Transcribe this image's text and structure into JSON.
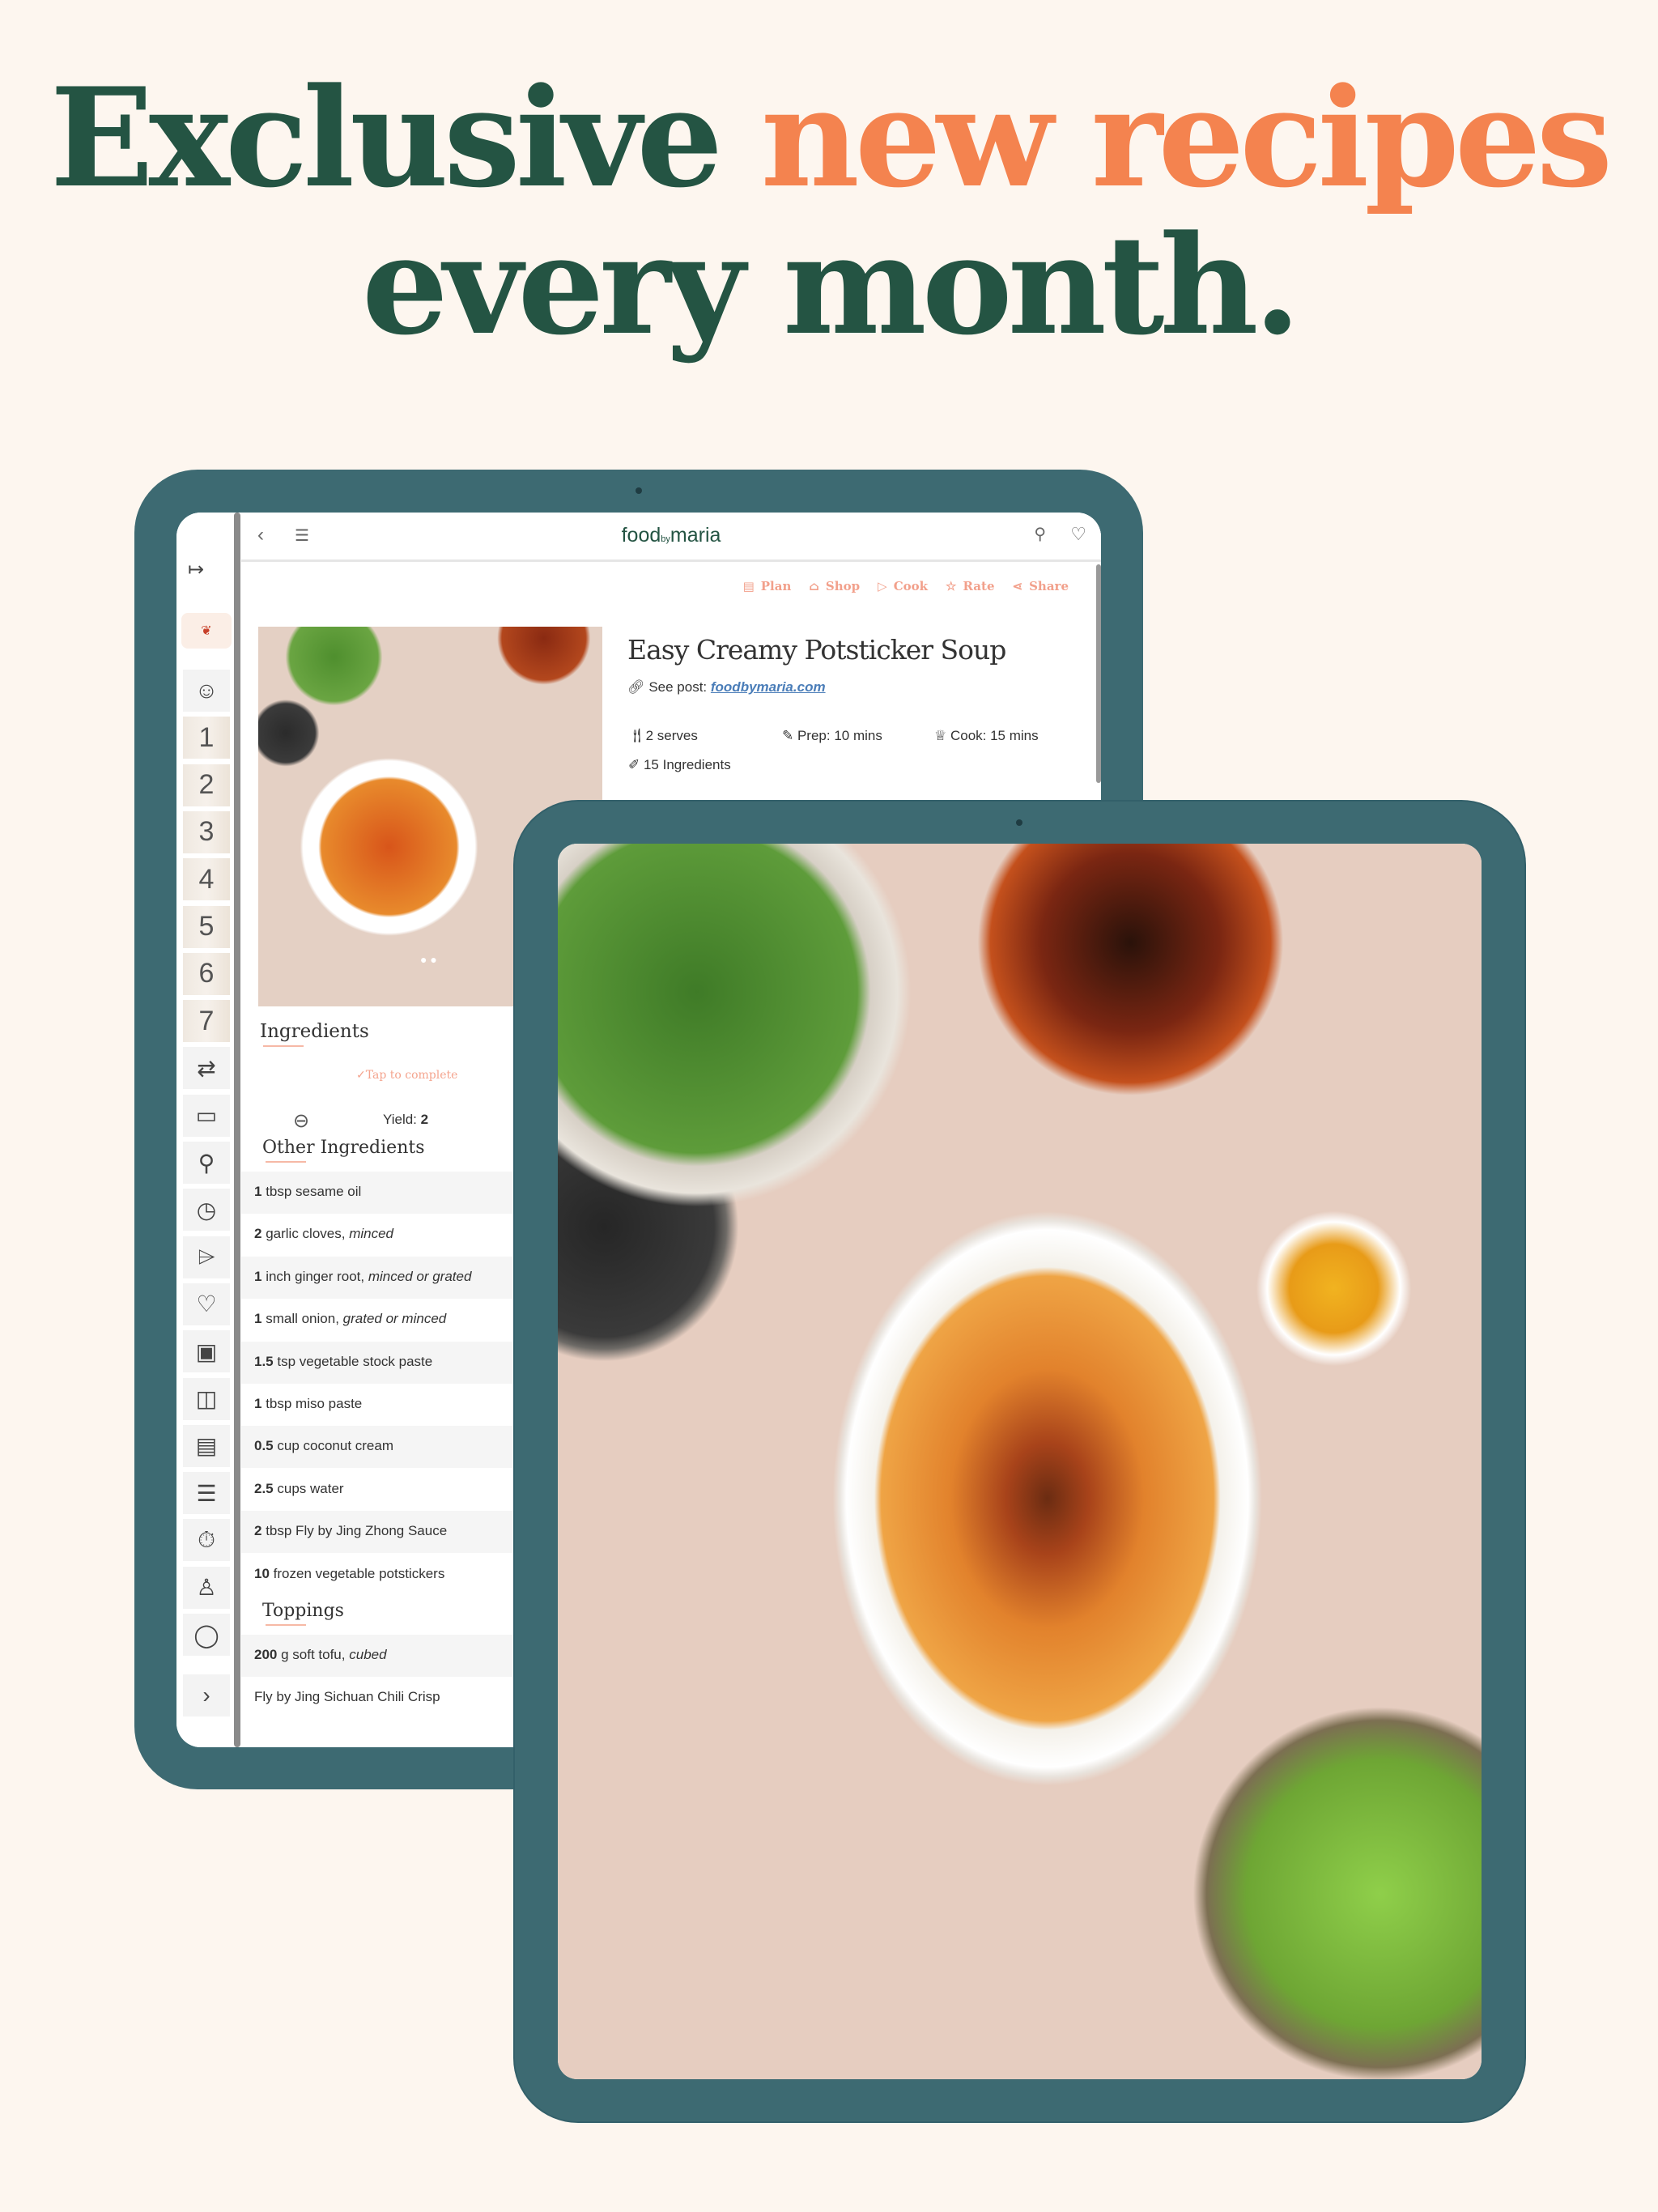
{
  "headline": {
    "line1_a": "Exclusive ",
    "line1_b": "new recipes",
    "line2": "every month."
  },
  "colors": {
    "background": "#fdf6ef",
    "brand_green": "#245443",
    "accent_orange": "#f4834f",
    "bezel": "#3d6a72",
    "action_pink": "#f2a08b",
    "link_blue": "#4a7db8"
  },
  "app": {
    "logo": {
      "food": "food",
      "by": "by",
      "maria": "maria"
    },
    "topbar": {
      "back_icon": "chevron-left-icon",
      "menu_icon": "hamburger-icon",
      "pin_icon": "pin-icon",
      "favorite_icon": "heart-icon"
    },
    "sidebar": {
      "expand_icon": "arrow-right-bar-icon",
      "logo_alt": "foodbymaria",
      "items": [
        {
          "icon": "user-icon"
        },
        {
          "label": "1"
        },
        {
          "label": "2"
        },
        {
          "label": "3"
        },
        {
          "label": "4"
        },
        {
          "label": "5"
        },
        {
          "label": "6"
        },
        {
          "label": "7"
        },
        {
          "icon": "swap-icon"
        },
        {
          "icon": "book-icon"
        },
        {
          "icon": "search-icon"
        },
        {
          "icon": "clock-icon"
        },
        {
          "icon": "tags-icon"
        },
        {
          "icon": "heart-icon"
        },
        {
          "icon": "pantry-icon"
        },
        {
          "icon": "saved-icon"
        },
        {
          "icon": "calendar-icon"
        },
        {
          "icon": "checklist-icon"
        },
        {
          "icon": "timer-icon"
        },
        {
          "icon": "chef-icon"
        },
        {
          "icon": "chat-icon"
        }
      ],
      "next_icon": "chevron-right-icon"
    },
    "actions": [
      {
        "label": "Plan",
        "icon": "calendar-icon"
      },
      {
        "label": "Shop",
        "icon": "basket-icon"
      },
      {
        "label": "Cook",
        "icon": "play-icon"
      },
      {
        "label": "Rate",
        "icon": "star-icon"
      },
      {
        "label": "Share",
        "icon": "share-icon"
      }
    ],
    "recipe": {
      "title": "Easy Creamy Potsticker Soup",
      "see_post_label": "See post:",
      "see_post_link": "foodbymaria.com",
      "serves": "2 serves",
      "prep": "Prep: 10 mins",
      "cook": "Cook: 15 mins",
      "ingredient_count": "15 Ingredients"
    },
    "ingredients": {
      "heading": "Ingredients",
      "tap_to_complete": "Tap to complete",
      "yield_label": "Yield:",
      "yield_value": "2",
      "sections": [
        {
          "title": "Other Ingredients",
          "items": [
            {
              "qty": "1",
              "text": "tbsp sesame oil",
              "note": ""
            },
            {
              "qty": "2",
              "text": "garlic cloves,",
              "note": "minced"
            },
            {
              "qty": "1",
              "text": "inch ginger root,",
              "note": "minced or grated"
            },
            {
              "qty": "1",
              "text": "small onion,",
              "note": "grated or minced"
            },
            {
              "qty": "1.5",
              "text": "tsp vegetable stock paste",
              "note": ""
            },
            {
              "qty": "1",
              "text": "tbsp miso paste",
              "note": ""
            },
            {
              "qty": "0.5",
              "text": "cup coconut cream",
              "note": ""
            },
            {
              "qty": "2.5",
              "text": "cups water",
              "note": ""
            },
            {
              "qty": "2",
              "text": "tbsp Fly by Jing Zhong Sauce",
              "note": ""
            },
            {
              "qty": "10",
              "text": "frozen vegetable potstickers",
              "note": ""
            }
          ]
        },
        {
          "title": "Toppings",
          "items": [
            {
              "qty": "200",
              "text": "g soft tofu,",
              "note": "cubed"
            },
            {
              "qty": "",
              "text": "Fly by Jing Sichuan Chili Crisp",
              "note": ""
            }
          ]
        }
      ]
    }
  }
}
